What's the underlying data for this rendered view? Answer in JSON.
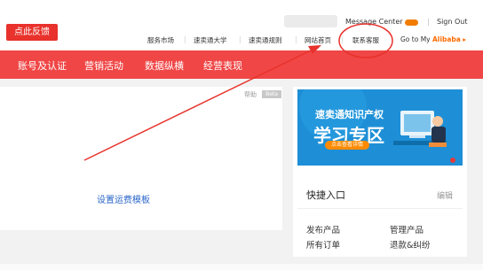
{
  "header": {
    "feedback": "点此反馈",
    "message_center": "Message Center",
    "separator": "|",
    "sign_out": "Sign Out",
    "links": [
      "服务市场",
      "速卖通大学",
      "速卖通规则",
      "网站首页",
      "联系客服"
    ],
    "go_to": "Go to My ",
    "alibaba": "Alibaba",
    "arrow": "▸"
  },
  "nav": [
    "账号及认证",
    "营销活动",
    "数据纵横",
    "经营表现"
  ],
  "left_panel": {
    "help": "帮助",
    "beta": "Beta",
    "freight_link": "设置运费模板"
  },
  "banner": {
    "line1": "速卖通知识产权",
    "line2": "学习专区",
    "button": "点击查看详情"
  },
  "quick": {
    "title": "快捷入口",
    "edit": "编辑",
    "items": [
      "发布产品",
      "管理产品",
      "所有订单",
      "退款&纠纷"
    ]
  },
  "colors": {
    "brand_red": "#f04646",
    "link_blue": "#2a66c8",
    "annotation_red": "#e8322b",
    "alibaba_orange": "#ff6a00"
  }
}
